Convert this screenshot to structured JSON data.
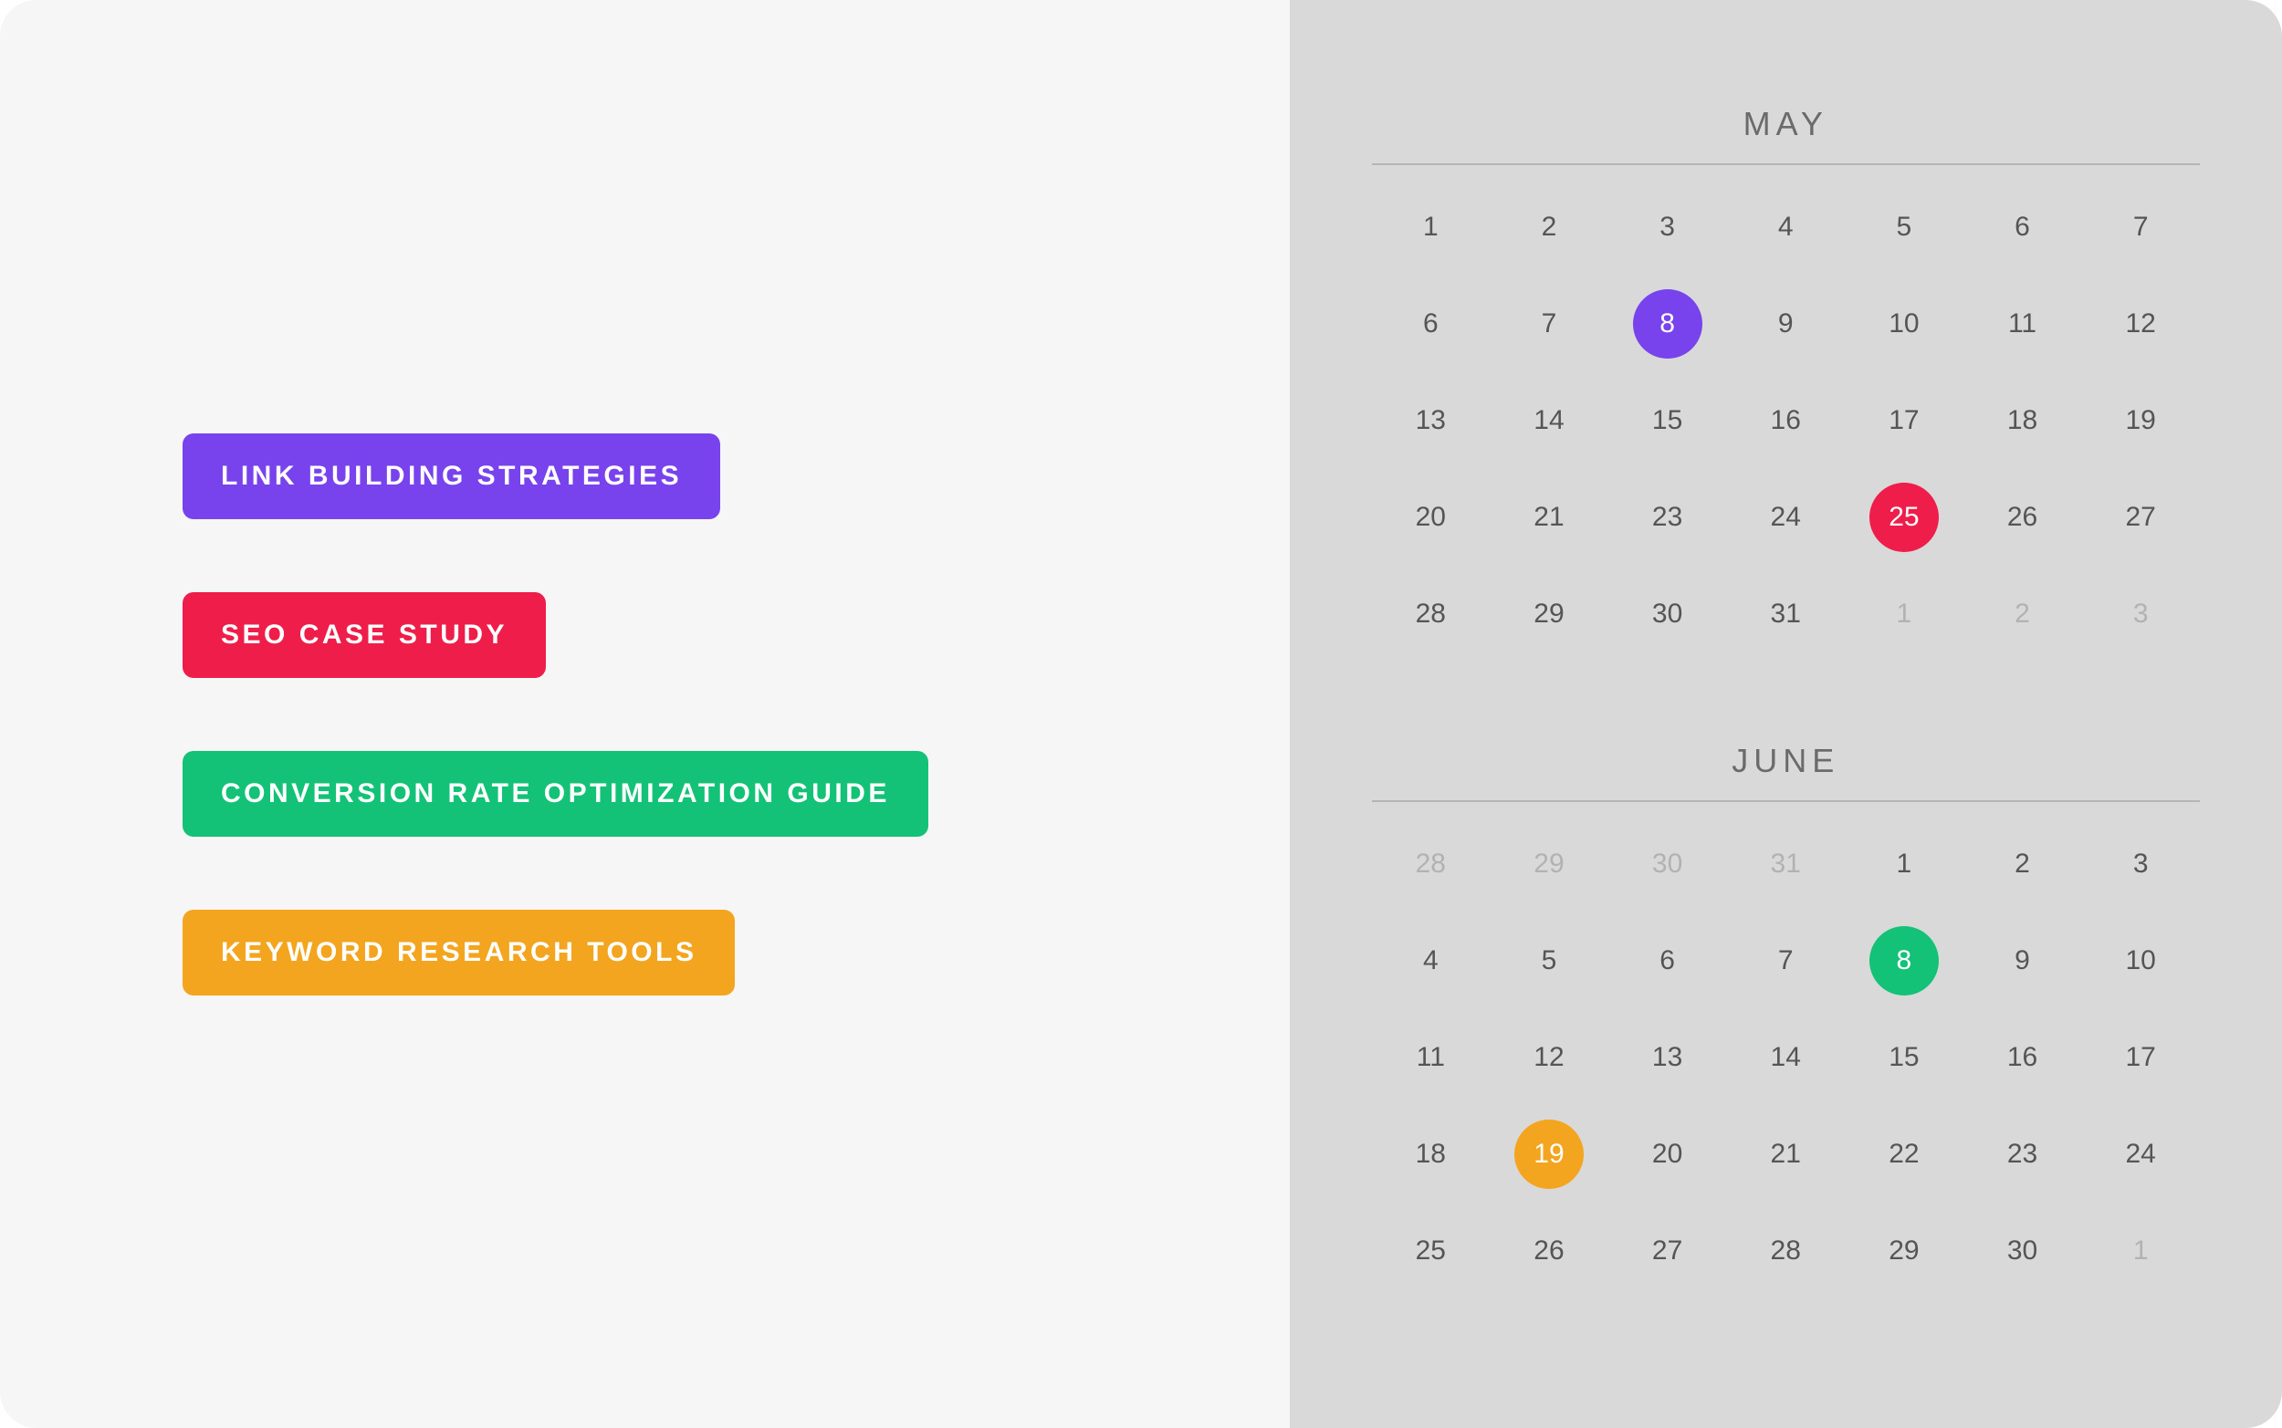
{
  "colors": {
    "purple": "#7842ed",
    "red": "#ee1d4a",
    "green": "#14c277",
    "orange": "#f3a51f"
  },
  "tags": [
    {
      "label": "Link Building Strategies",
      "color": "purple"
    },
    {
      "label": "SEO Case Study",
      "color": "red"
    },
    {
      "label": "Conversion Rate Optimization Guide",
      "color": "green"
    },
    {
      "label": "Keyword Research Tools",
      "color": "orange"
    }
  ],
  "calendars": [
    {
      "title": "May",
      "days": [
        {
          "n": 1
        },
        {
          "n": 2
        },
        {
          "n": 3
        },
        {
          "n": 4
        },
        {
          "n": 5
        },
        {
          "n": 6
        },
        {
          "n": 7
        },
        {
          "n": 6
        },
        {
          "n": 7
        },
        {
          "n": 8,
          "mark": "purple"
        },
        {
          "n": 9
        },
        {
          "n": 10
        },
        {
          "n": 11
        },
        {
          "n": 12
        },
        {
          "n": 13
        },
        {
          "n": 14
        },
        {
          "n": 15
        },
        {
          "n": 16
        },
        {
          "n": 17
        },
        {
          "n": 18
        },
        {
          "n": 19
        },
        {
          "n": 20
        },
        {
          "n": 21
        },
        {
          "n": 23
        },
        {
          "n": 24
        },
        {
          "n": 25,
          "mark": "red"
        },
        {
          "n": 26
        },
        {
          "n": 27
        },
        {
          "n": 28
        },
        {
          "n": 29
        },
        {
          "n": 30
        },
        {
          "n": 31
        },
        {
          "n": 1,
          "out": true
        },
        {
          "n": 2,
          "out": true
        },
        {
          "n": 3,
          "out": true
        }
      ]
    },
    {
      "title": "June",
      "days": [
        {
          "n": 28,
          "out": true
        },
        {
          "n": 29,
          "out": true
        },
        {
          "n": 30,
          "out": true
        },
        {
          "n": 31,
          "out": true
        },
        {
          "n": 1
        },
        {
          "n": 2
        },
        {
          "n": 3
        },
        {
          "n": 4
        },
        {
          "n": 5
        },
        {
          "n": 6
        },
        {
          "n": 7
        },
        {
          "n": 8,
          "mark": "green"
        },
        {
          "n": 9
        },
        {
          "n": 10
        },
        {
          "n": 11
        },
        {
          "n": 12
        },
        {
          "n": 13
        },
        {
          "n": 14
        },
        {
          "n": 15
        },
        {
          "n": 16
        },
        {
          "n": 17
        },
        {
          "n": 18
        },
        {
          "n": 19,
          "mark": "orange"
        },
        {
          "n": 20
        },
        {
          "n": 21
        },
        {
          "n": 22
        },
        {
          "n": 23
        },
        {
          "n": 24
        },
        {
          "n": 25
        },
        {
          "n": 26
        },
        {
          "n": 27
        },
        {
          "n": 28
        },
        {
          "n": 29
        },
        {
          "n": 30
        },
        {
          "n": 1,
          "out": true
        }
      ]
    }
  ]
}
